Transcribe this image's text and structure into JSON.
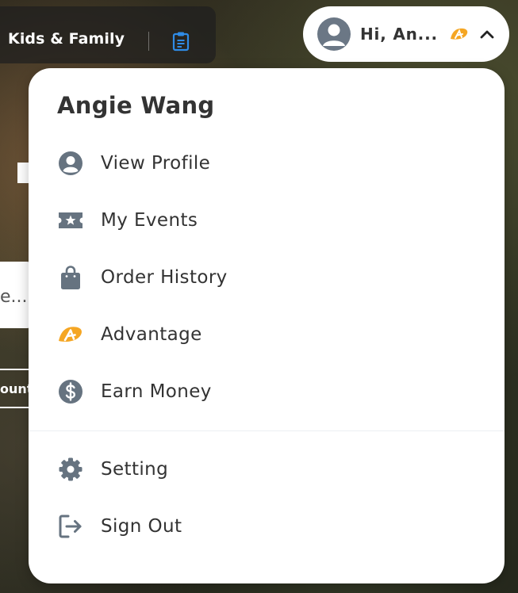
{
  "nav": {
    "kids_family": "Kids & Family"
  },
  "background": {
    "fragment_1": "e...",
    "fragment_2": "ount"
  },
  "user_pill": {
    "greeting": "Hi, An..."
  },
  "dropdown": {
    "user_name": "Angie Wang",
    "menu_items": [
      {
        "label": "View Profile",
        "icon": "user-circle-icon"
      },
      {
        "label": "My Events",
        "icon": "ticket-star-icon"
      },
      {
        "label": "Order History",
        "icon": "shopping-bag-icon"
      },
      {
        "label": "Advantage",
        "icon": "advantage-logo-icon"
      },
      {
        "label": "Earn Money",
        "icon": "dollar-circle-icon"
      }
    ],
    "footer_items": [
      {
        "label": "Setting",
        "icon": "gear-icon"
      },
      {
        "label": "Sign Out",
        "icon": "sign-out-icon"
      }
    ]
  },
  "colors": {
    "icon_gray": "#667380",
    "text_dark": "#333333",
    "advantage_orange": "#f5a623",
    "clipboard_blue": "#2f8be6"
  }
}
